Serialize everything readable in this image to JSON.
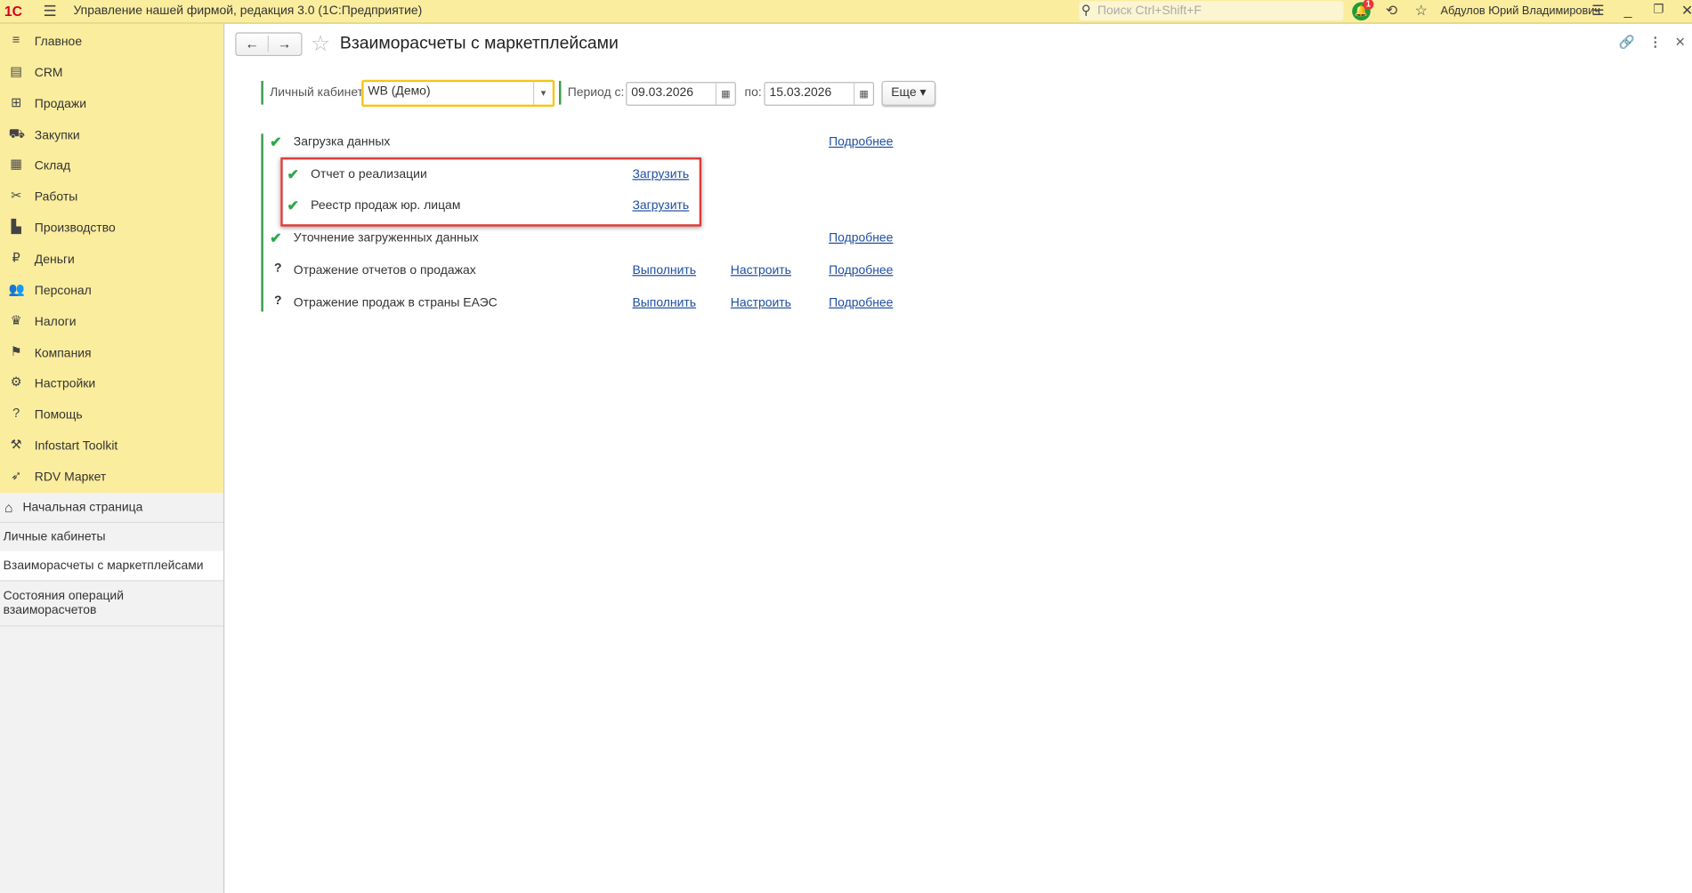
{
  "topbar": {
    "logo": "1С",
    "app_title": "Управление нашей фирмой, редакция 3.0  (1С:Предприятие)",
    "search_placeholder": "Поиск Ctrl+Shift+F",
    "notif_count": "1",
    "user": "Абдулов Юрий Владимирович"
  },
  "sidebar": {
    "items": [
      {
        "label": "Главное",
        "icon": "≡"
      },
      {
        "label": "CRM",
        "icon": "▤"
      },
      {
        "label": "Продажи",
        "icon": "⊞"
      },
      {
        "label": "Закупки",
        "icon": "⛟"
      },
      {
        "label": "Склад",
        "icon": "▦"
      },
      {
        "label": "Работы",
        "icon": "✂"
      },
      {
        "label": "Производство",
        "icon": "▙"
      },
      {
        "label": "Деньги",
        "icon": "₽"
      },
      {
        "label": "Персонал",
        "icon": "👥"
      },
      {
        "label": "Налоги",
        "icon": "♛"
      },
      {
        "label": "Компания",
        "icon": "⚑"
      },
      {
        "label": "Настройки",
        "icon": "⚙"
      },
      {
        "label": "Помощь",
        "icon": "?"
      },
      {
        "label": "Infostart Toolkit",
        "icon": "⚒"
      },
      {
        "label": "RDV Маркет",
        "icon": "➶"
      }
    ],
    "open": [
      {
        "label": "Начальная страница"
      },
      {
        "label": "Личные кабинеты"
      },
      {
        "label": "Взаиморасчеты с маркетплейсами"
      },
      {
        "label": "Состояния операций взаиморасчетов"
      }
    ]
  },
  "page": {
    "title": "Взаиморасчеты с маркетплейсами",
    "cabinet_label": "Личный кабинет:",
    "cabinet_value": "WB (Демо)",
    "period_from_label": "Период с:",
    "period_from": "09.03.2026",
    "period_to_label": "по:",
    "period_to": "15.03.2026",
    "more_label": "Еще ▾",
    "steps": [
      {
        "label": "Загрузка данных",
        "status": "done",
        "details": "Подробнее"
      },
      {
        "label": "Отчет о реализации",
        "status": "done",
        "load": "Загрузить"
      },
      {
        "label": "Реестр продаж юр. лицам",
        "status": "done",
        "load": "Загрузить"
      },
      {
        "label": "Уточнение загруженных данных",
        "status": "done",
        "details": "Подробнее"
      },
      {
        "label": "Отражение отчетов о продажах",
        "status": "unknown",
        "run": "Выполнить",
        "setup": "Настроить",
        "details": "Подробнее"
      },
      {
        "label": "Отражение продаж в страны ЕАЭС",
        "status": "unknown",
        "run": "Выполнить",
        "setup": "Настроить",
        "details": "Подробнее"
      }
    ]
  }
}
